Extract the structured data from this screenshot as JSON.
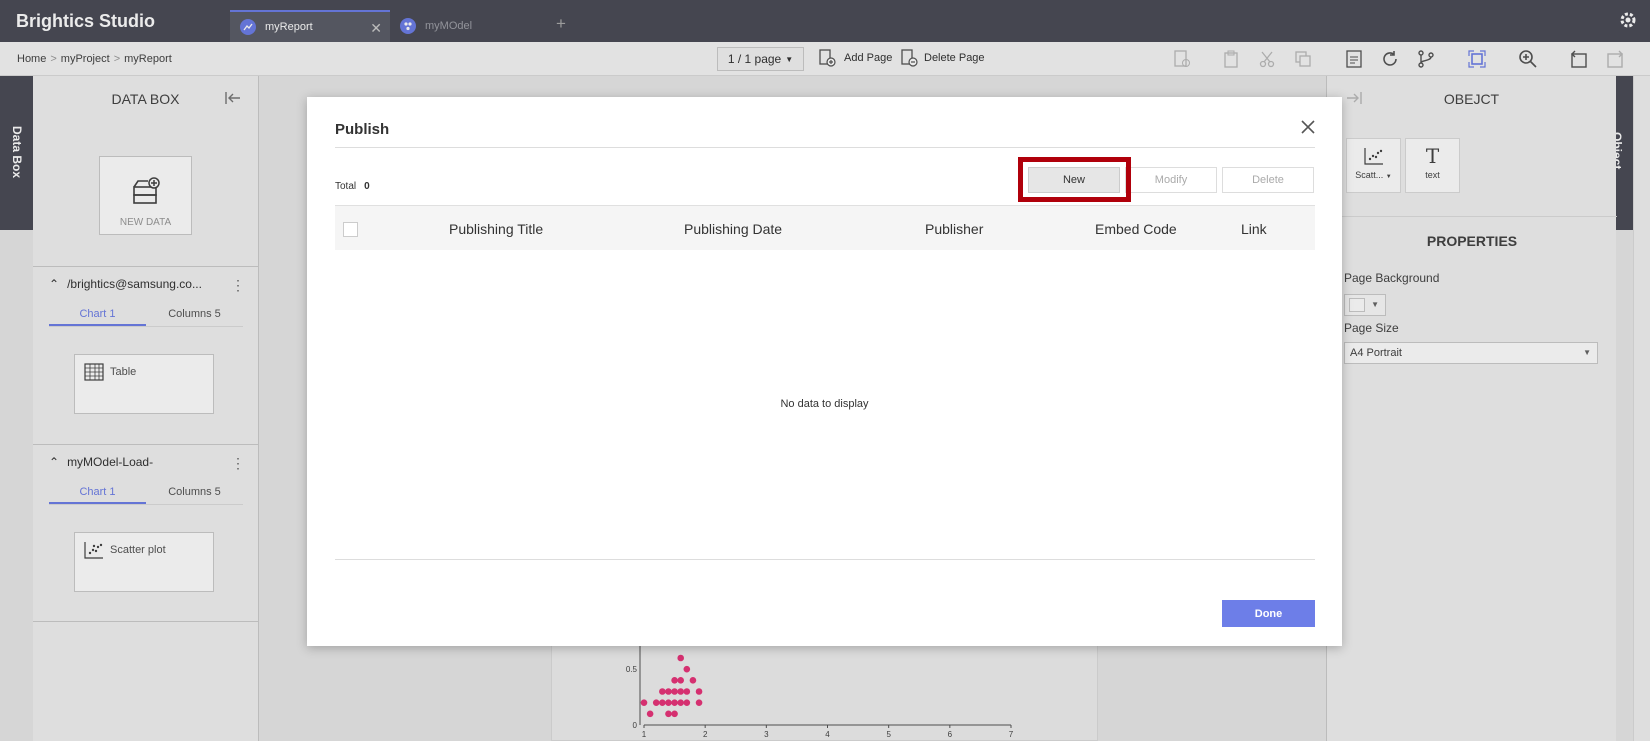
{
  "app": {
    "title": "Brightics Studio"
  },
  "tabs": [
    {
      "label": "myReport"
    },
    {
      "label": "myMOdel"
    }
  ],
  "breadcrumb": [
    "Home",
    "myProject",
    "myReport"
  ],
  "toolbar": {
    "page_indicator": "1 / 1 page",
    "add_page": "Add Page",
    "delete_page": "Delete Page"
  },
  "side_strips": {
    "left": "Data Box",
    "right": "Object"
  },
  "data_box": {
    "title": "DATA BOX",
    "new_data_label": "NEW DATA",
    "datasets": [
      {
        "name": "/brightics@samsung.co...",
        "tabs": [
          "Chart 1",
          "Columns 5"
        ],
        "item": "Table"
      },
      {
        "name": "myMOdel-Load-",
        "tabs": [
          "Chart 1",
          "Columns 5"
        ],
        "item": "Scatter plot"
      }
    ]
  },
  "object_panel": {
    "title": "OBEJCT",
    "objects": [
      "Scatt...",
      "text"
    ],
    "properties_title": "PROPERTIES",
    "page_background_label": "Page Background",
    "page_size_label": "Page Size",
    "page_size_value": "A4 Portrait"
  },
  "publish_dialog": {
    "title": "Publish",
    "total_label": "Total",
    "total_value": "0",
    "buttons": {
      "new": "New",
      "modify": "Modify",
      "delete": "Delete",
      "done": "Done"
    },
    "columns": [
      "Publishing Title",
      "Publishing Date",
      "Publisher",
      "Embed Code",
      "Link"
    ],
    "empty_message": "No data to display"
  },
  "colors": {
    "accent": "#6d7ee8",
    "highlight": "#b0000b",
    "topbar": "#4b4d57",
    "point": "#e8357a"
  },
  "chart_data": {
    "type": "scatter",
    "xlim": [
      1,
      7
    ],
    "ylim": [
      0,
      0.6
    ],
    "x_ticks": [
      "1",
      "2",
      "3",
      "4",
      "5",
      "6",
      "7"
    ],
    "y_ticks": [
      "0",
      "0.5"
    ],
    "points": [
      [
        1.0,
        0.2
      ],
      [
        1.1,
        0.1
      ],
      [
        1.2,
        0.2
      ],
      [
        1.3,
        0.2
      ],
      [
        1.3,
        0.3
      ],
      [
        1.4,
        0.2
      ],
      [
        1.4,
        0.3
      ],
      [
        1.4,
        0.1
      ],
      [
        1.5,
        0.2
      ],
      [
        1.5,
        0.3
      ],
      [
        1.5,
        0.4
      ],
      [
        1.5,
        0.1
      ],
      [
        1.6,
        0.2
      ],
      [
        1.6,
        0.3
      ],
      [
        1.6,
        0.4
      ],
      [
        1.6,
        0.6
      ],
      [
        1.7,
        0.2
      ],
      [
        1.7,
        0.3
      ],
      [
        1.7,
        0.5
      ],
      [
        1.8,
        0.4
      ],
      [
        1.9,
        0.2
      ],
      [
        1.9,
        0.3
      ]
    ]
  }
}
